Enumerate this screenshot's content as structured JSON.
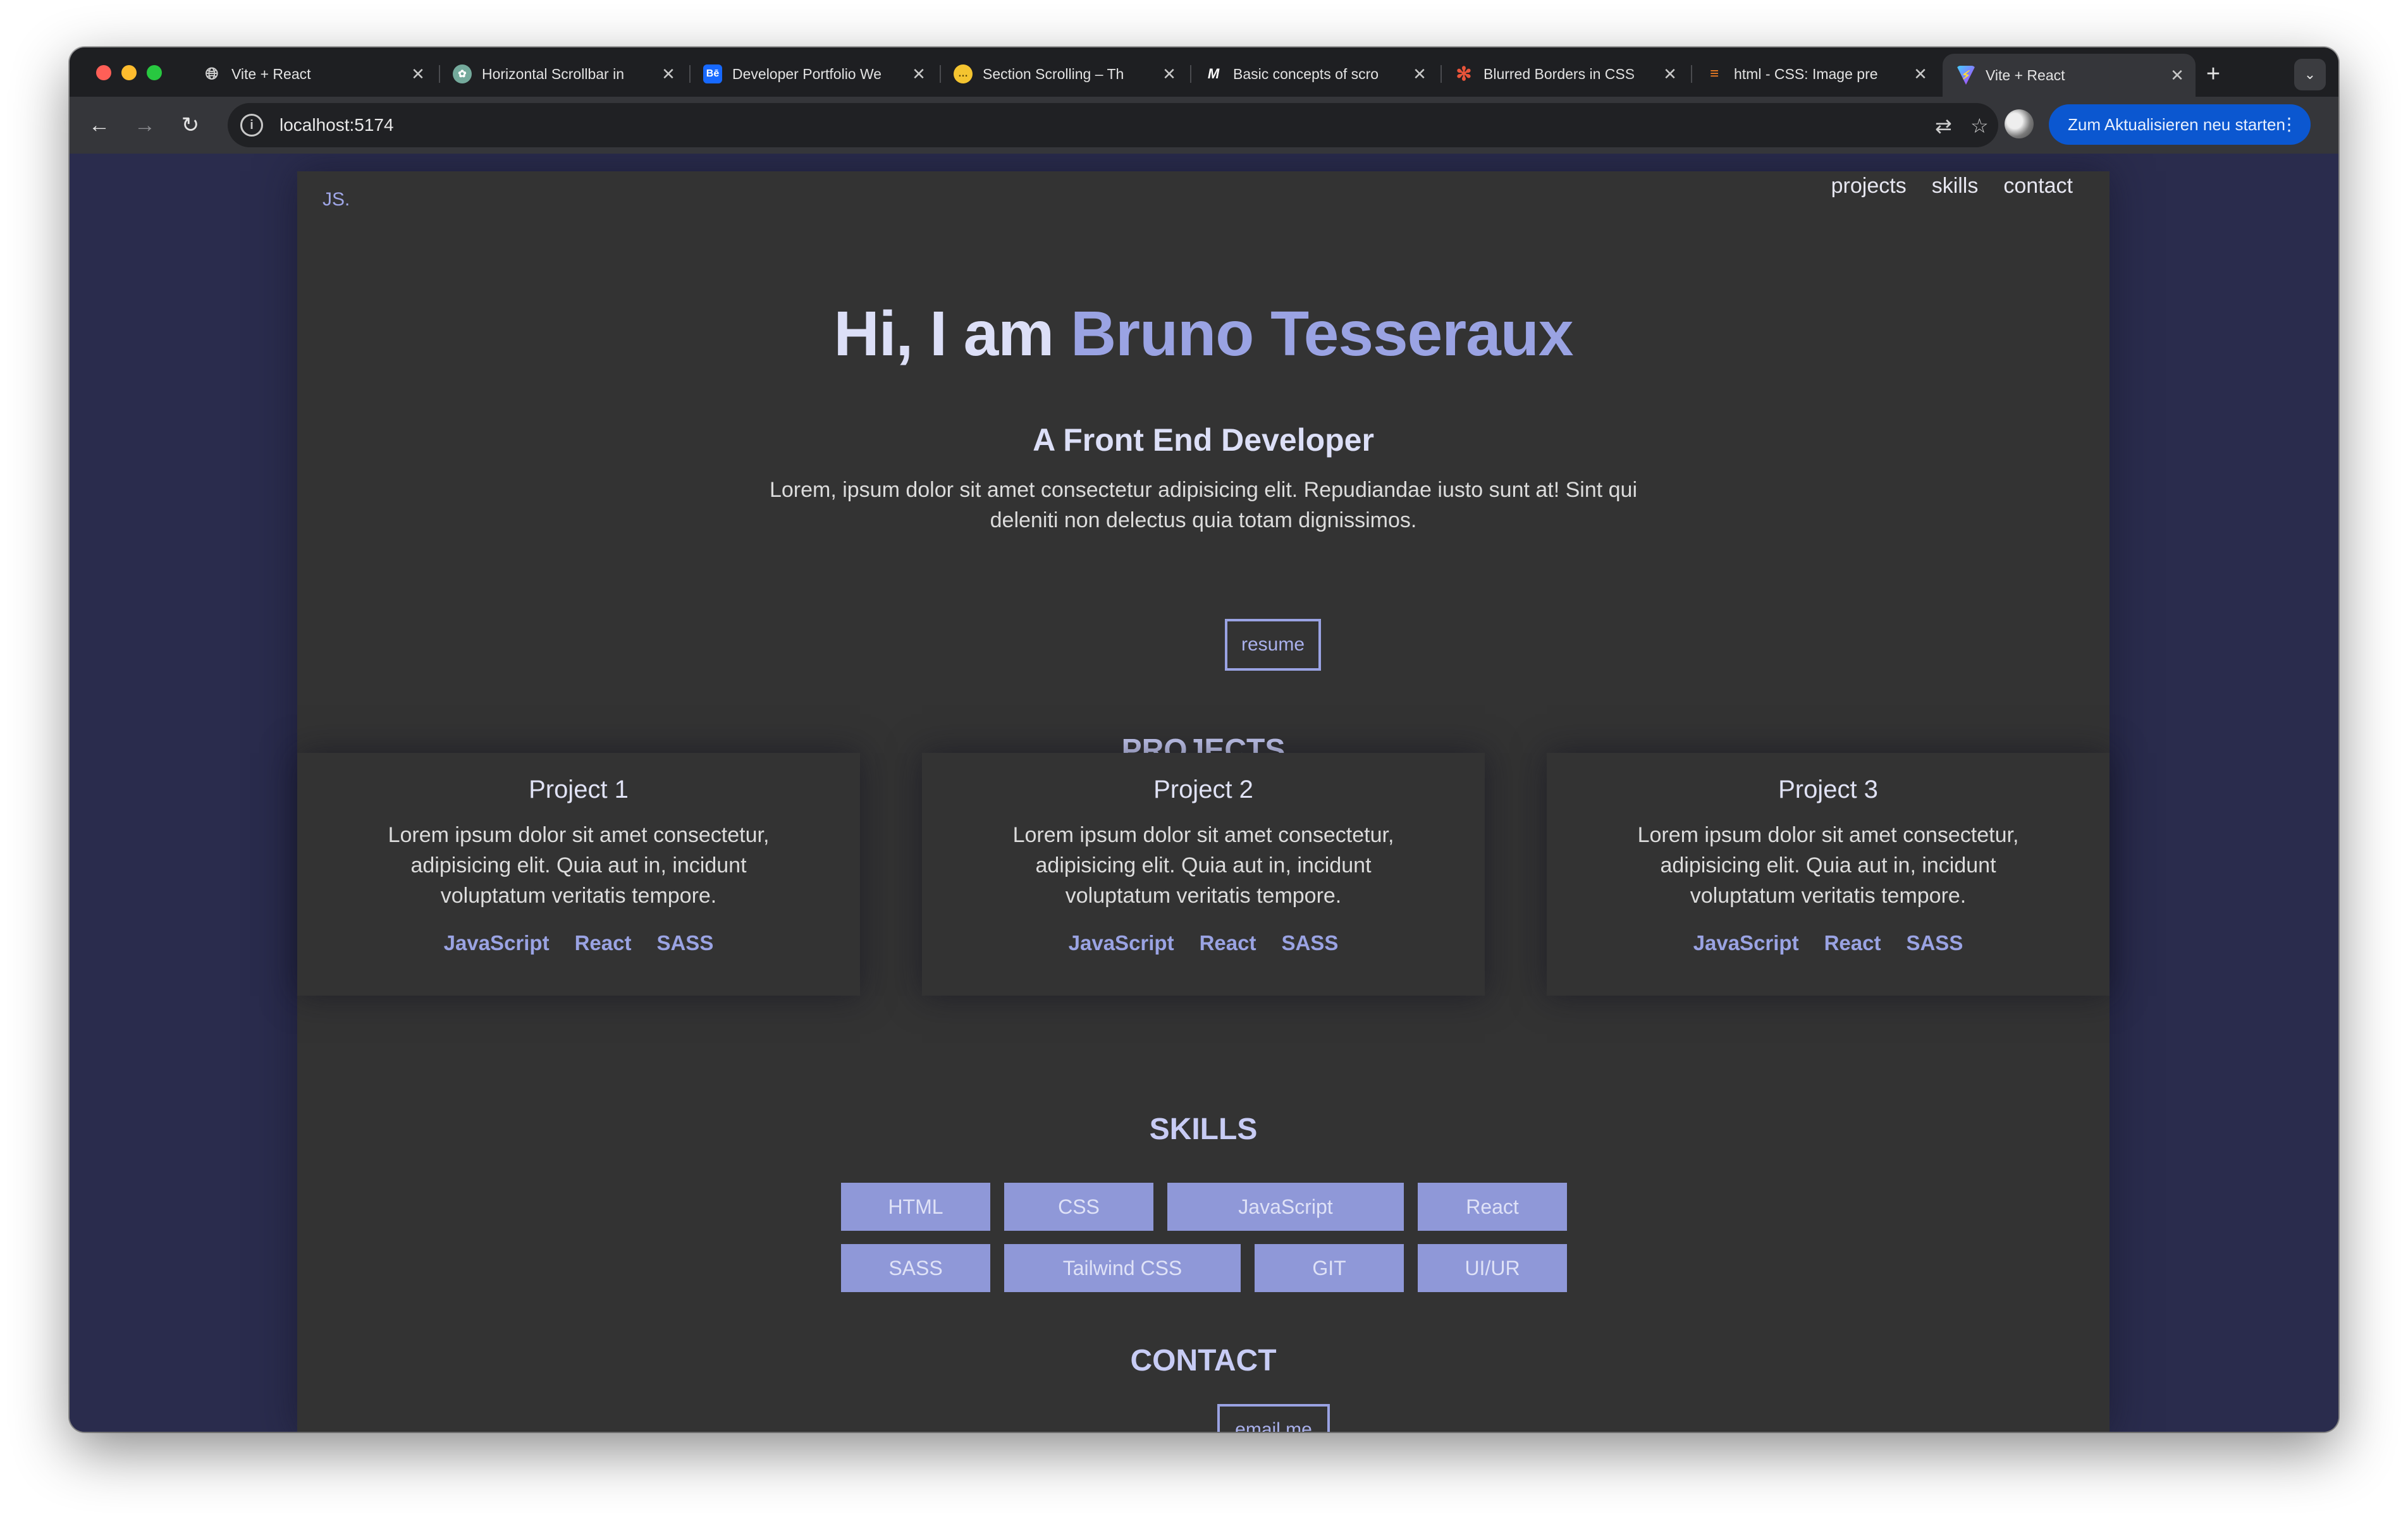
{
  "browser": {
    "tabs": [
      {
        "label": "Vite + React",
        "icon": "globe-icon"
      },
      {
        "label": "Horizontal Scrollbar in",
        "icon": "chatgpt-icon"
      },
      {
        "label": "Developer Portfolio We",
        "icon": "behance-icon"
      },
      {
        "label": "Section Scrolling – Th",
        "icon": "chat-bubble-icon"
      },
      {
        "label": "Basic concepts of scro",
        "icon": "mdn-icon"
      },
      {
        "label": "Blurred Borders in CSS",
        "icon": "asterisk-icon"
      },
      {
        "label": "html - CSS: Image pre",
        "icon": "stackoverflow-icon"
      },
      {
        "label": "Vite + React",
        "icon": "vite-icon"
      }
    ],
    "new_tab": "+",
    "url": "localhost:5174",
    "update_button": "Zum Aktualisieren neu starten"
  },
  "site": {
    "logo": "JS.",
    "nav": [
      "projects",
      "skills",
      "contact"
    ],
    "hero": {
      "greeting": "Hi, I am ",
      "name": "Bruno Tesseraux",
      "subtitle": "A Front End Developer",
      "description": "Lorem, ipsum dolor sit amet consectetur adipisicing elit. Repudiandae iusto sunt at! Sint qui deleniti non delectus quia totam dignissimos.",
      "button": "resume"
    },
    "projects": {
      "title": "PROJECTS",
      "items": [
        {
          "title": "Project 1",
          "description": "Lorem ipsum dolor sit amet consectetur, adipisicing elit. Quia aut in, incidunt voluptatum veritatis tempore.",
          "tags": [
            "JavaScript",
            "React",
            "SASS"
          ]
        },
        {
          "title": "Project 2",
          "description": "Lorem ipsum dolor sit amet consectetur, adipisicing elit. Quia aut in, incidunt voluptatum veritatis tempore.",
          "tags": [
            "JavaScript",
            "React",
            "SASS"
          ]
        },
        {
          "title": "Project 3",
          "description": "Lorem ipsum dolor sit amet consectetur, adipisicing elit. Quia aut in, incidunt voluptatum veritatis tempore.",
          "tags": [
            "JavaScript",
            "React",
            "SASS"
          ]
        }
      ]
    },
    "skills": {
      "title": "SKILLS",
      "items": [
        "HTML",
        "CSS",
        "JavaScript",
        "React",
        "SASS",
        "Tailwind CSS",
        "GIT",
        "UI/UR"
      ]
    },
    "contact": {
      "title": "CONTACT",
      "button": "email me"
    }
  },
  "colors": {
    "page_background": "#2a2c4d",
    "site_background": "#333333",
    "accent": "#9aa3e3",
    "skill_badge": "#8f98d8"
  }
}
